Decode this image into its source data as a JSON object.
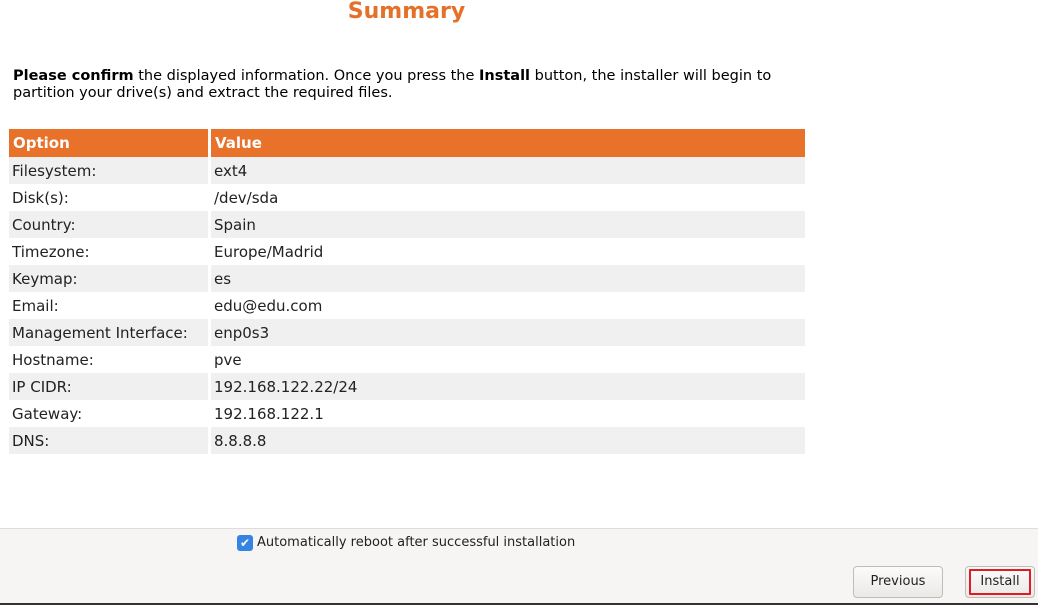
{
  "header": {
    "title": "Summary"
  },
  "intro": {
    "bold_start": "Please confirm",
    "text_1": " the displayed information. Once you press the ",
    "bold_install": "Install",
    "text_2": " button, the installer will begin to partition your drive(s) and extract the required files."
  },
  "table": {
    "headers": [
      "Option",
      "Value"
    ],
    "rows": [
      [
        "Filesystem:",
        "ext4"
      ],
      [
        "Disk(s):",
        "/dev/sda"
      ],
      [
        "Country:",
        "Spain"
      ],
      [
        "Timezone:",
        "Europe/Madrid"
      ],
      [
        "Keymap:",
        "es"
      ],
      [
        "Email:",
        "edu@edu.com"
      ],
      [
        "Management Interface:",
        "enp0s3"
      ],
      [
        "Hostname:",
        "pve"
      ],
      [
        "IP CIDR:",
        "192.168.122.22/24"
      ],
      [
        "Gateway:",
        "192.168.122.1"
      ],
      [
        "DNS:",
        "8.8.8.8"
      ]
    ]
  },
  "reboot": {
    "checked": true,
    "label": "Automatically reboot after successful installation"
  },
  "buttons": {
    "previous": "Previous",
    "install": "Install"
  },
  "colors": {
    "accent": "#e8722a",
    "checkbox": "#3584e4",
    "focus": "#e01b24"
  }
}
